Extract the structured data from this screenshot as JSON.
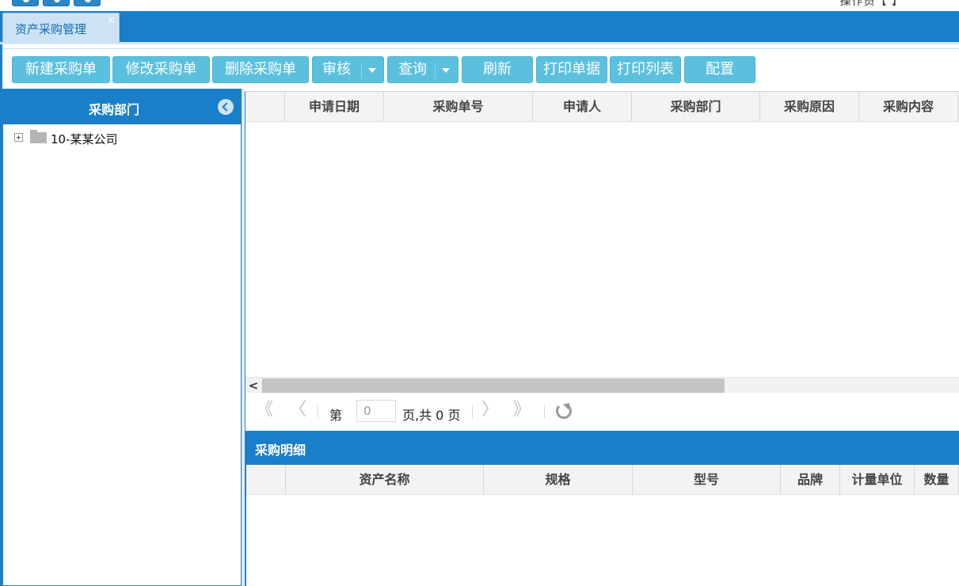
{
  "top": {
    "right_text": "操作员【      】"
  },
  "tabs": [
    {
      "label": "资产采购管理",
      "close": "×"
    }
  ],
  "toolbar": {
    "new_order": "新建采购单",
    "edit_order": "修改采购单",
    "delete_order": "删除采购单",
    "audit": "审核",
    "query": "查询",
    "refresh": "刷新",
    "print_doc": "打印单据",
    "print_list": "打印列表",
    "config": "配置"
  },
  "left_panel": {
    "title": "采购部门",
    "tree": [
      {
        "label": "10-某某公司",
        "expanded": false
      }
    ]
  },
  "orders_grid": {
    "columns": [
      "",
      "申请日期",
      "采购单号",
      "申请人",
      "采购部门",
      "采购原因",
      "采购内容"
    ],
    "rows": []
  },
  "pager": {
    "first": "《",
    "prev": "〈",
    "page_prefix": "第",
    "page_value": "0",
    "page_suffix": "页,共 0 页",
    "next": "〉",
    "last": "》"
  },
  "detail": {
    "title": "采购明细",
    "columns": [
      "",
      "资产名称",
      "规格",
      "型号",
      "品牌",
      "计量单位",
      "数量"
    ],
    "rows": []
  },
  "colors": {
    "primary_blue": "#1a7fca",
    "button_cyan": "#5bc0de",
    "header_gray": "#f3f3f3"
  }
}
